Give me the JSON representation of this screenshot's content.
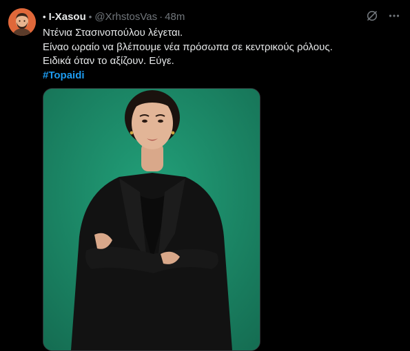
{
  "author": {
    "display_name": "I-Xasou",
    "handle": "@XrhstosVas",
    "time": "48m",
    "bullet": "•",
    "separator": "•",
    "dot": "·"
  },
  "tweet": {
    "lines": [
      "Ντένια Στασινοπούλου λέγεται.",
      "Είναο ωραίο να βλέπουμε νέα πρόσωπα σε κεντρικούς ρόλους.",
      "Ειδικά όταν το αξίζουν. Εύγε."
    ],
    "hashtag": "#Topaidi"
  },
  "colors": {
    "background": "#000000",
    "text": "#e7e9ea",
    "muted": "#71767b",
    "link": "#1d9bf0",
    "photo_wall": "#1d8c68",
    "avatar_bg": "#e0683a"
  },
  "icons": {
    "grok": "grok-icon",
    "more": "more-icon"
  }
}
